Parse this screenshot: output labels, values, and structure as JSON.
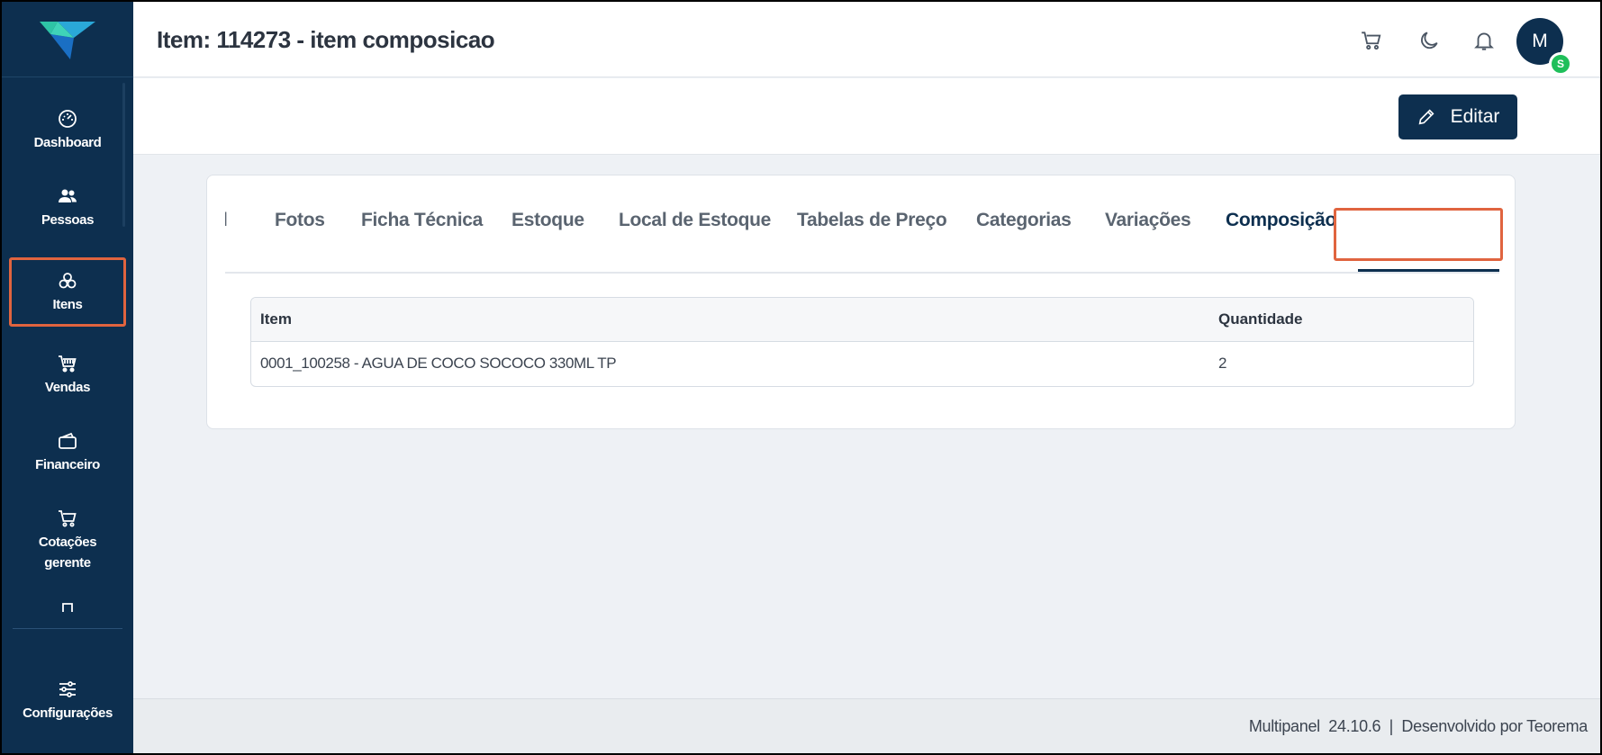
{
  "header": {
    "title": "Item: 114273 - item composicao",
    "avatar_initial": "M",
    "avatar_badge": "S",
    "icons": [
      "cart-icon",
      "moon-icon",
      "bell-icon"
    ]
  },
  "sidebar": {
    "items": [
      {
        "label": "Dashboard",
        "icon": "dashboard-icon"
      },
      {
        "label": "Pessoas",
        "icon": "people-icon"
      },
      {
        "label": "Itens",
        "icon": "items-icon",
        "active": true
      },
      {
        "label": "Vendas",
        "icon": "sales-cart-icon"
      },
      {
        "label": "Financeiro",
        "icon": "wallet-icon"
      },
      {
        "label": "Cotações gerente",
        "icon": "cart-icon"
      },
      {
        "label": "",
        "icon": "partial-icon"
      },
      {
        "label": "Configurações",
        "icon": "settings-sliders-icon"
      }
    ]
  },
  "actions": {
    "edit_label": "Editar"
  },
  "tabs": [
    {
      "label": "l"
    },
    {
      "label": "Fotos"
    },
    {
      "label": "Ficha Técnica"
    },
    {
      "label": "Estoque"
    },
    {
      "label": "Local de Estoque"
    },
    {
      "label": "Tabelas de Preço"
    },
    {
      "label": "Categorias"
    },
    {
      "label": "Variações"
    },
    {
      "label": "Composição",
      "active": true
    }
  ],
  "table": {
    "columns": [
      "Item",
      "Quantidade"
    ],
    "rows": [
      [
        "0001_100258 - AGUA DE COCO SOCOCO 330ML TP",
        "2"
      ]
    ]
  },
  "footer": {
    "text": "Multipanel  24.10.6  |  Desenvolvido por Teorema"
  },
  "colors": {
    "primary": "#0d2f4f",
    "highlight": "#e0643f",
    "badge": "#1fbf5a"
  }
}
